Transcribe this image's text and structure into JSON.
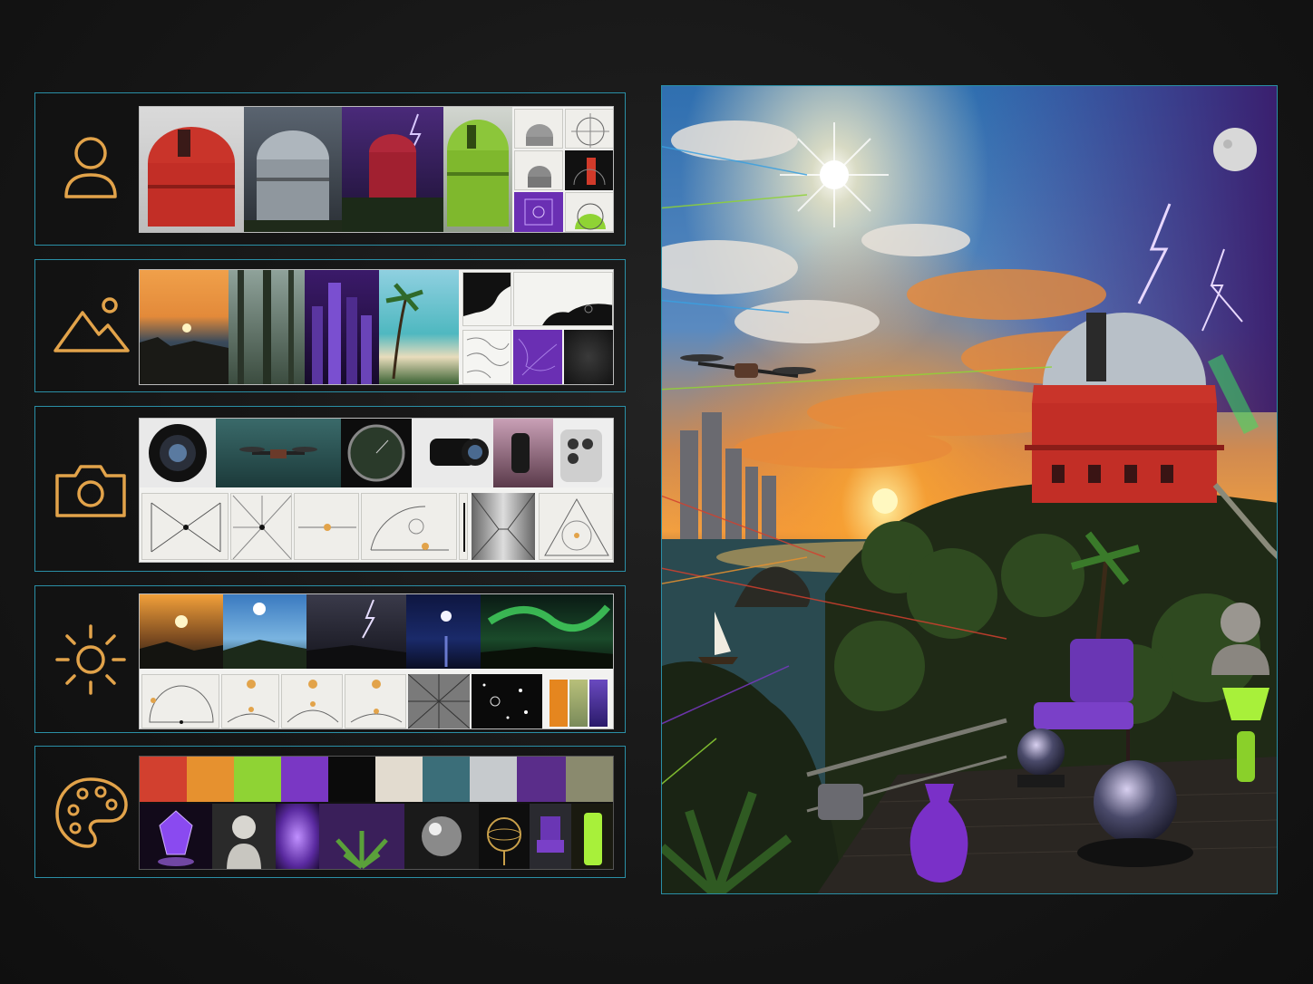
{
  "colors": {
    "panel_border": "#2a8fa6",
    "icon_orange": "#e2a34a",
    "background": "#181818"
  },
  "rows": [
    {
      "id": "subject",
      "icon": "person-icon"
    },
    {
      "id": "scene",
      "icon": "landscape-icon"
    },
    {
      "id": "camera",
      "icon": "camera-icon"
    },
    {
      "id": "lighting",
      "icon": "sun-icon"
    },
    {
      "id": "palette",
      "icon": "palette-icon"
    }
  ],
  "palette_swatches": [
    "#d2402f",
    "#e6912f",
    "#8fd334",
    "#7a37c4",
    "#0b0b0b",
    "#e2dbcf",
    "#3b6e79",
    "#c6cacd",
    "#5a2d8a",
    "#8a8a6e"
  ],
  "gradient_swatches": [
    "#e5861f",
    "#9ea86a",
    "#4b2fa0"
  ],
  "main_image": {
    "icon": "composite-scene-image"
  }
}
